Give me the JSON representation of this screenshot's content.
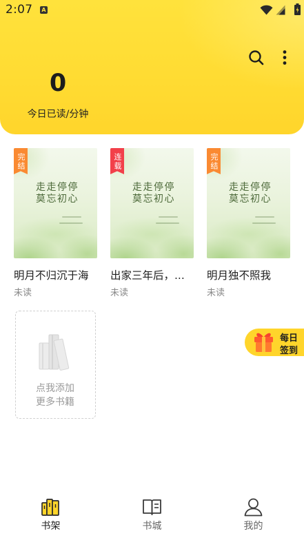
{
  "status_bar": {
    "time": "2:07",
    "notification_glyph": "A",
    "icons": [
      "wifi-icon",
      "signal-icon",
      "battery-icon"
    ]
  },
  "header": {
    "read_minutes": "0",
    "read_label": "今日已读/分钟",
    "actions": [
      "search-icon",
      "more-vertical-icon"
    ]
  },
  "books": [
    {
      "title": "明月不归沉于海",
      "badge": "完结",
      "badge_color": "#FA8A32",
      "read_state": "未读",
      "cover_lines": [
        "走走停停",
        "莫忘初心"
      ]
    },
    {
      "title": "出家三年后，...",
      "badge": "连载",
      "badge_color": "#F2404A",
      "read_state": "未读",
      "cover_lines": [
        "走走停停",
        "莫忘初心"
      ]
    },
    {
      "title": "明月独不照我",
      "badge": "完结",
      "badge_color": "#FA8A32",
      "read_state": "未读",
      "cover_lines": [
        "走走停停",
        "莫忘初心"
      ]
    }
  ],
  "add_book": {
    "line1": "点我添加",
    "line2": "更多书籍"
  },
  "sign_in": {
    "line1": "每日",
    "line2": "签到",
    "icon": "gift-icon"
  },
  "bottom_nav": {
    "items": [
      {
        "label": "书架",
        "icon": "bookshelf-icon",
        "active": true
      },
      {
        "label": "书城",
        "icon": "book-open-icon",
        "active": false
      },
      {
        "label": "我的",
        "icon": "user-icon",
        "active": false
      }
    ]
  },
  "colors": {
    "accent": "#FFD52B",
    "text_primary": "#1F1F1F",
    "text_secondary": "#888888"
  }
}
